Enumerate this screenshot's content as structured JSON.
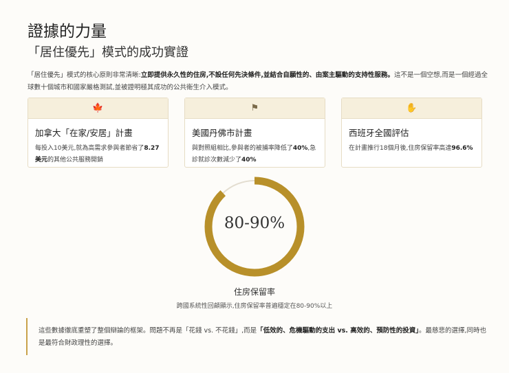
{
  "title": "證據的力量",
  "subtitle": "「居住優先」模式的成功實證",
  "intro": {
    "p1": "「居住優先」模式的核心原則非常清晰:",
    "b1": "立即提供永久性的住房,不設任何先決條件,並結合自願性的、由案主驅動的支持性服務。",
    "p2": "這不是一個空想,而是一個經過全球數十個城市和國家嚴格測試,並被證明極其成功的公共衛生介入模式。"
  },
  "cards": [
    {
      "icon": "maple-leaf-icon",
      "glyph": "🍁",
      "title": "加拿大「在家/安居」計畫",
      "t1": "每投入10美元,就為高需求參與者節省了",
      "b1": "8.27美元",
      "t2": "的其他公共服務開銷"
    },
    {
      "icon": "flag-icon",
      "glyph": "⚑",
      "title": "美國丹佛市計畫",
      "t1": "與對照組相比,參與者的被捕率降低了",
      "b1": "40%",
      "t2": ",急診就診次數減少了",
      "b2": "40%"
    },
    {
      "icon": "hand-heart-icon",
      "glyph": "✋",
      "title": "西班牙全國評估",
      "t1": "在計畫推行18個月後,住房保留率高達",
      "b1": "96.6%"
    }
  ],
  "donut": {
    "value": "80-90%",
    "fraction": 0.88,
    "label": "住房保留率",
    "sub": "跨國系統性回顧顯示,住房保留率普遍穩定在80-90%以上",
    "color": "#b8902a",
    "track": "#e3ddd0"
  },
  "note": {
    "p1": "這些數據徹底重塑了整個辯論的框架。問題不再是「花錢 vs. 不花錢」,而是",
    "b1": "「低效的、危機驅動的支出 vs. 高效的、預防性的投資」",
    "p2": "。最慈悲的選擇,同時也是最符合財政理性的選擇。"
  }
}
